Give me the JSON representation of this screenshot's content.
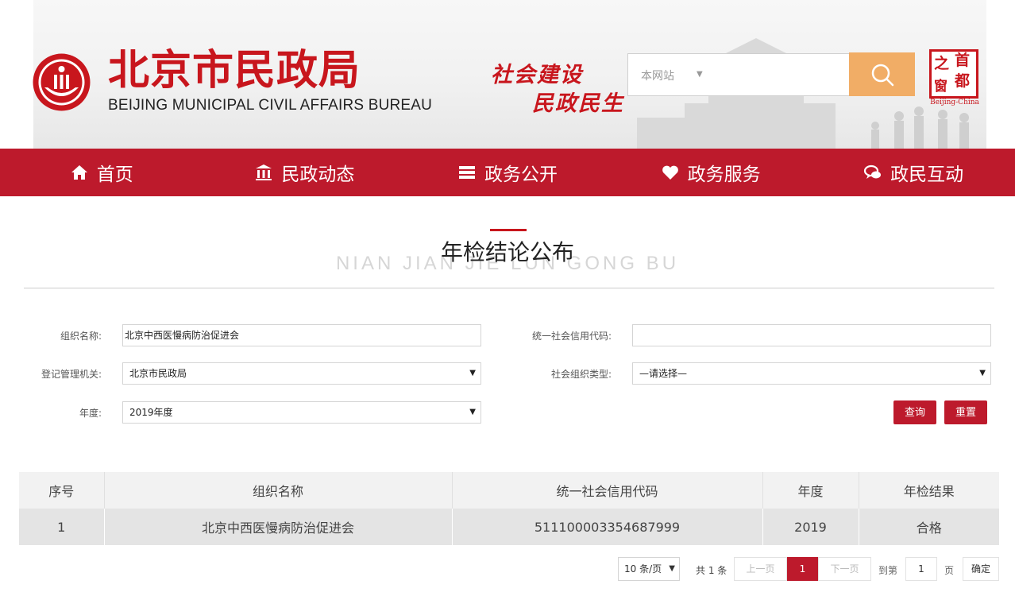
{
  "header": {
    "logo_cn": "北京市民政局",
    "logo_en": "BEIJING MUNICIPAL CIVIL AFFAIRS BUREAU",
    "slogan_line1": "社会建设",
    "slogan_line2": "民政民生",
    "search": {
      "scope": "本网站",
      "placeholder": ""
    },
    "capital_badge": {
      "chars": [
        "之",
        "首",
        "窗",
        "都"
      ],
      "en": "Beijing-China"
    }
  },
  "nav": [
    {
      "label": "首页",
      "icon": "home-icon"
    },
    {
      "label": "民政动态",
      "icon": "bank-icon"
    },
    {
      "label": "政务公开",
      "icon": "list-icon"
    },
    {
      "label": "政务服务",
      "icon": "heart-icon"
    },
    {
      "label": "政民互动",
      "icon": "chat-icon"
    }
  ],
  "page_title": {
    "cn": "年检结论公布",
    "en": "NIAN JIAN JIE LUN GONG BU"
  },
  "form": {
    "org_name": {
      "label": "组织名称:",
      "value": "北京中西医慢病防治促进会"
    },
    "credit_code": {
      "label": "统一社会信用代码:",
      "value": ""
    },
    "registry": {
      "label": "登记管理机关:",
      "value": "北京市民政局"
    },
    "org_type": {
      "label": "社会组织类型:",
      "value": "—请选择—"
    },
    "year": {
      "label": "年度:",
      "value": "2019年度"
    },
    "query_label": "查询",
    "reset_label": "重置"
  },
  "table": {
    "headers": [
      "序号",
      "组织名称",
      "统一社会信用代码",
      "年度",
      "年检结果"
    ],
    "rows": [
      [
        "1",
        "北京中西医慢病防治促进会",
        "511100003354687999",
        "2019",
        "合格"
      ]
    ]
  },
  "pagination": {
    "page_size": "10 条/页",
    "total": "共 1 条",
    "prev": "上一页",
    "current": "1",
    "next": "下一页",
    "goto_label": "到第",
    "goto_value": "1",
    "page_suffix": "页",
    "confirm": "确定"
  },
  "colors": {
    "brand_red": "#bd1a2c",
    "search_orange": "#f1ad66"
  }
}
